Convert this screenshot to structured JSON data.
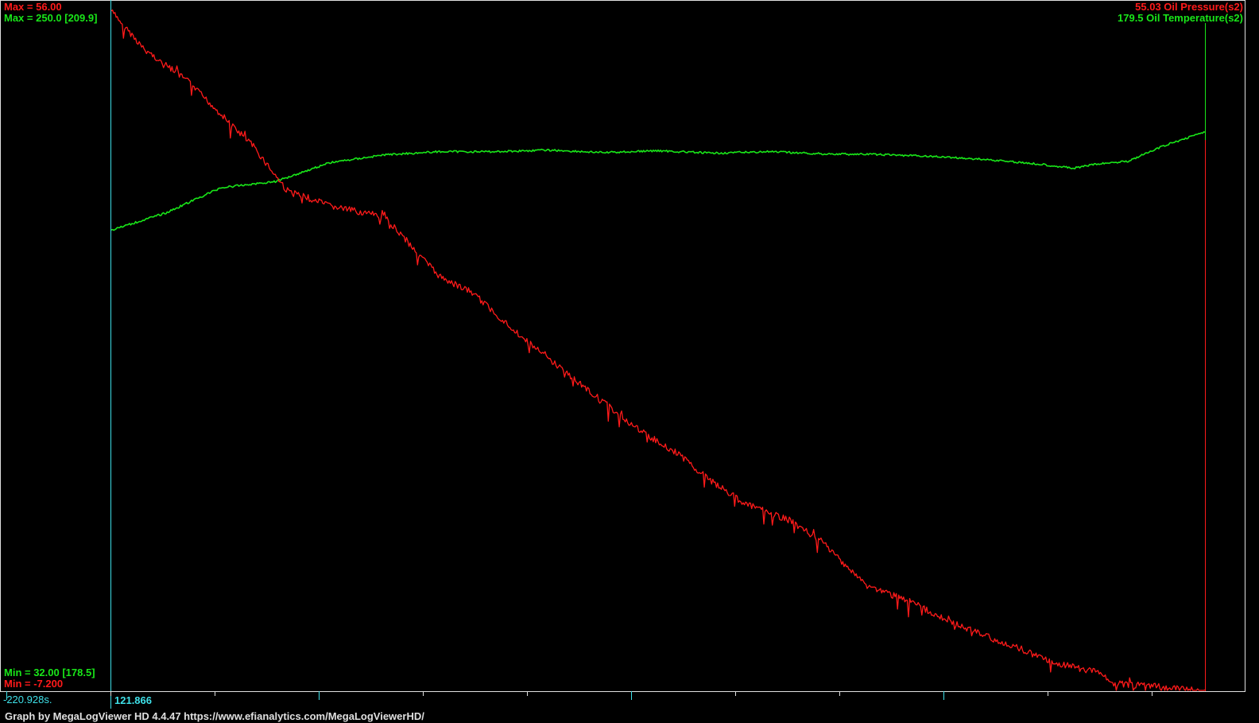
{
  "header": {
    "max_pressure": "Max = 56.00",
    "max_temperature": "Max = 250.0 [209.9]",
    "pressure_readout": "55.03  Oil Pressure(s2)",
    "temperature_readout": "179.5  Oil Temperature(s2)"
  },
  "bottom": {
    "min_temperature": "Min = 32.00 [178.5]",
    "min_pressure": "Min = -7.200",
    "time_offset": "-220.928s.",
    "cursor_time": "121.866"
  },
  "footer": {
    "credit": "Graph by MegaLogViewer HD 4.4.47 https://www.efianalytics.com/MegaLogViewerHD/"
  },
  "colors": {
    "background": "#000000",
    "pressure": "#ff1a1a",
    "temperature": "#19e619",
    "cursor": "#3ee0e8",
    "axis": "#e0e0e0"
  },
  "chart_data": {
    "type": "line",
    "x_span": [
      0,
      1
    ],
    "series": [
      {
        "name": "Oil Pressure(s2)",
        "color": "#ff1a1a",
        "ylim": [
          -7.2,
          56.0
        ],
        "x": [
          0,
          0.03,
          0.07,
          0.1,
          0.13,
          0.16,
          0.2,
          0.25,
          0.3,
          0.33,
          0.38,
          0.43,
          0.48,
          0.52,
          0.55,
          0.58,
          0.62,
          0.65,
          0.69,
          0.73,
          0.77,
          0.8,
          0.83,
          0.86,
          0.9,
          0.92,
          0.95,
          0.975,
          1.0
        ],
        "values": [
          55.5,
          52.0,
          49.0,
          46.0,
          43.0,
          39.0,
          37.5,
          36.5,
          31.0,
          29.5,
          25.0,
          21.0,
          17.0,
          14.5,
          12.0,
          10.0,
          8.5,
          6.5,
          2.5,
          1.0,
          -1.0,
          -2.2,
          -3.3,
          -4.6,
          -5.5,
          -6.6,
          -6.8,
          -7.0,
          -7.2
        ]
      },
      {
        "name": "Oil Temperature(s2)",
        "color": "#19e619",
        "ylim": [
          32.0,
          250.0
        ],
        "x": [
          0,
          0.05,
          0.1,
          0.15,
          0.2,
          0.25,
          0.3,
          0.35,
          0.4,
          0.45,
          0.5,
          0.55,
          0.6,
          0.65,
          0.7,
          0.75,
          0.8,
          0.85,
          0.88,
          0.9,
          0.93,
          0.96,
          1.0
        ],
        "values": [
          178.5,
          184.0,
          192.0,
          194.0,
          200.0,
          202.5,
          203.5,
          203.5,
          204.0,
          203.2,
          203.8,
          203.0,
          203.5,
          202.8,
          202.6,
          202.0,
          201.0,
          199.5,
          198.2,
          199.5,
          200.5,
          205.0,
          209.9
        ]
      }
    ]
  }
}
